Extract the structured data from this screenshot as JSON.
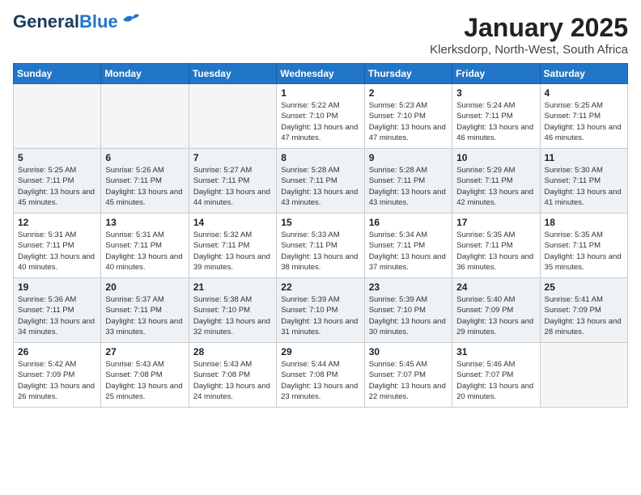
{
  "logo": {
    "line1": "General",
    "line2": "Blue"
  },
  "title": "January 2025",
  "subtitle": "Klerksdorp, North-West, South Africa",
  "weekdays": [
    "Sunday",
    "Monday",
    "Tuesday",
    "Wednesday",
    "Thursday",
    "Friday",
    "Saturday"
  ],
  "weeks": [
    [
      {
        "day": "",
        "info": ""
      },
      {
        "day": "",
        "info": ""
      },
      {
        "day": "",
        "info": ""
      },
      {
        "day": "1",
        "info": "Sunrise: 5:22 AM\nSunset: 7:10 PM\nDaylight: 13 hours and 47 minutes."
      },
      {
        "day": "2",
        "info": "Sunrise: 5:23 AM\nSunset: 7:10 PM\nDaylight: 13 hours and 47 minutes."
      },
      {
        "day": "3",
        "info": "Sunrise: 5:24 AM\nSunset: 7:11 PM\nDaylight: 13 hours and 46 minutes."
      },
      {
        "day": "4",
        "info": "Sunrise: 5:25 AM\nSunset: 7:11 PM\nDaylight: 13 hours and 46 minutes."
      }
    ],
    [
      {
        "day": "5",
        "info": "Sunrise: 5:25 AM\nSunset: 7:11 PM\nDaylight: 13 hours and 45 minutes."
      },
      {
        "day": "6",
        "info": "Sunrise: 5:26 AM\nSunset: 7:11 PM\nDaylight: 13 hours and 45 minutes."
      },
      {
        "day": "7",
        "info": "Sunrise: 5:27 AM\nSunset: 7:11 PM\nDaylight: 13 hours and 44 minutes."
      },
      {
        "day": "8",
        "info": "Sunrise: 5:28 AM\nSunset: 7:11 PM\nDaylight: 13 hours and 43 minutes."
      },
      {
        "day": "9",
        "info": "Sunrise: 5:28 AM\nSunset: 7:11 PM\nDaylight: 13 hours and 43 minutes."
      },
      {
        "day": "10",
        "info": "Sunrise: 5:29 AM\nSunset: 7:11 PM\nDaylight: 13 hours and 42 minutes."
      },
      {
        "day": "11",
        "info": "Sunrise: 5:30 AM\nSunset: 7:11 PM\nDaylight: 13 hours and 41 minutes."
      }
    ],
    [
      {
        "day": "12",
        "info": "Sunrise: 5:31 AM\nSunset: 7:11 PM\nDaylight: 13 hours and 40 minutes."
      },
      {
        "day": "13",
        "info": "Sunrise: 5:31 AM\nSunset: 7:11 PM\nDaylight: 13 hours and 40 minutes."
      },
      {
        "day": "14",
        "info": "Sunrise: 5:32 AM\nSunset: 7:11 PM\nDaylight: 13 hours and 39 minutes."
      },
      {
        "day": "15",
        "info": "Sunrise: 5:33 AM\nSunset: 7:11 PM\nDaylight: 13 hours and 38 minutes."
      },
      {
        "day": "16",
        "info": "Sunrise: 5:34 AM\nSunset: 7:11 PM\nDaylight: 13 hours and 37 minutes."
      },
      {
        "day": "17",
        "info": "Sunrise: 5:35 AM\nSunset: 7:11 PM\nDaylight: 13 hours and 36 minutes."
      },
      {
        "day": "18",
        "info": "Sunrise: 5:35 AM\nSunset: 7:11 PM\nDaylight: 13 hours and 35 minutes."
      }
    ],
    [
      {
        "day": "19",
        "info": "Sunrise: 5:36 AM\nSunset: 7:11 PM\nDaylight: 13 hours and 34 minutes."
      },
      {
        "day": "20",
        "info": "Sunrise: 5:37 AM\nSunset: 7:11 PM\nDaylight: 13 hours and 33 minutes."
      },
      {
        "day": "21",
        "info": "Sunrise: 5:38 AM\nSunset: 7:10 PM\nDaylight: 13 hours and 32 minutes."
      },
      {
        "day": "22",
        "info": "Sunrise: 5:39 AM\nSunset: 7:10 PM\nDaylight: 13 hours and 31 minutes."
      },
      {
        "day": "23",
        "info": "Sunrise: 5:39 AM\nSunset: 7:10 PM\nDaylight: 13 hours and 30 minutes."
      },
      {
        "day": "24",
        "info": "Sunrise: 5:40 AM\nSunset: 7:09 PM\nDaylight: 13 hours and 29 minutes."
      },
      {
        "day": "25",
        "info": "Sunrise: 5:41 AM\nSunset: 7:09 PM\nDaylight: 13 hours and 28 minutes."
      }
    ],
    [
      {
        "day": "26",
        "info": "Sunrise: 5:42 AM\nSunset: 7:09 PM\nDaylight: 13 hours and 26 minutes."
      },
      {
        "day": "27",
        "info": "Sunrise: 5:43 AM\nSunset: 7:08 PM\nDaylight: 13 hours and 25 minutes."
      },
      {
        "day": "28",
        "info": "Sunrise: 5:43 AM\nSunset: 7:08 PM\nDaylight: 13 hours and 24 minutes."
      },
      {
        "day": "29",
        "info": "Sunrise: 5:44 AM\nSunset: 7:08 PM\nDaylight: 13 hours and 23 minutes."
      },
      {
        "day": "30",
        "info": "Sunrise: 5:45 AM\nSunset: 7:07 PM\nDaylight: 13 hours and 22 minutes."
      },
      {
        "day": "31",
        "info": "Sunrise: 5:46 AM\nSunset: 7:07 PM\nDaylight: 13 hours and 20 minutes."
      },
      {
        "day": "",
        "info": ""
      }
    ]
  ]
}
